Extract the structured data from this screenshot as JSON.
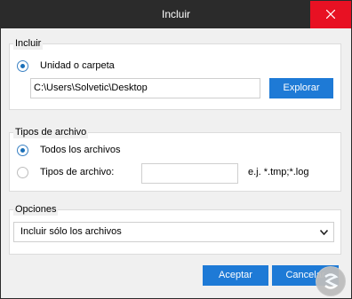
{
  "window": {
    "title": "Incluir"
  },
  "include_group": {
    "label": "Incluir",
    "radio_label": "Unidad o carpeta",
    "path_value": "C:\\Users\\Solvetic\\Desktop",
    "browse_label": "Explorar"
  },
  "filetype_group": {
    "label": "Tipos de archivo",
    "all_files_label": "Todos los archivos",
    "types_label": "Tipos de archivo:",
    "types_value": "",
    "example_text": "e.j. *.tmp;*.log"
  },
  "options_group": {
    "label": "Opciones",
    "selected_option": "Incluir sólo los archivos"
  },
  "footer": {
    "accept_label": "Aceptar",
    "cancel_label": "Cancelar"
  },
  "colors": {
    "titlebar": "#2b2b2b",
    "close": "#e81123",
    "accent": "#1e7ad6"
  }
}
